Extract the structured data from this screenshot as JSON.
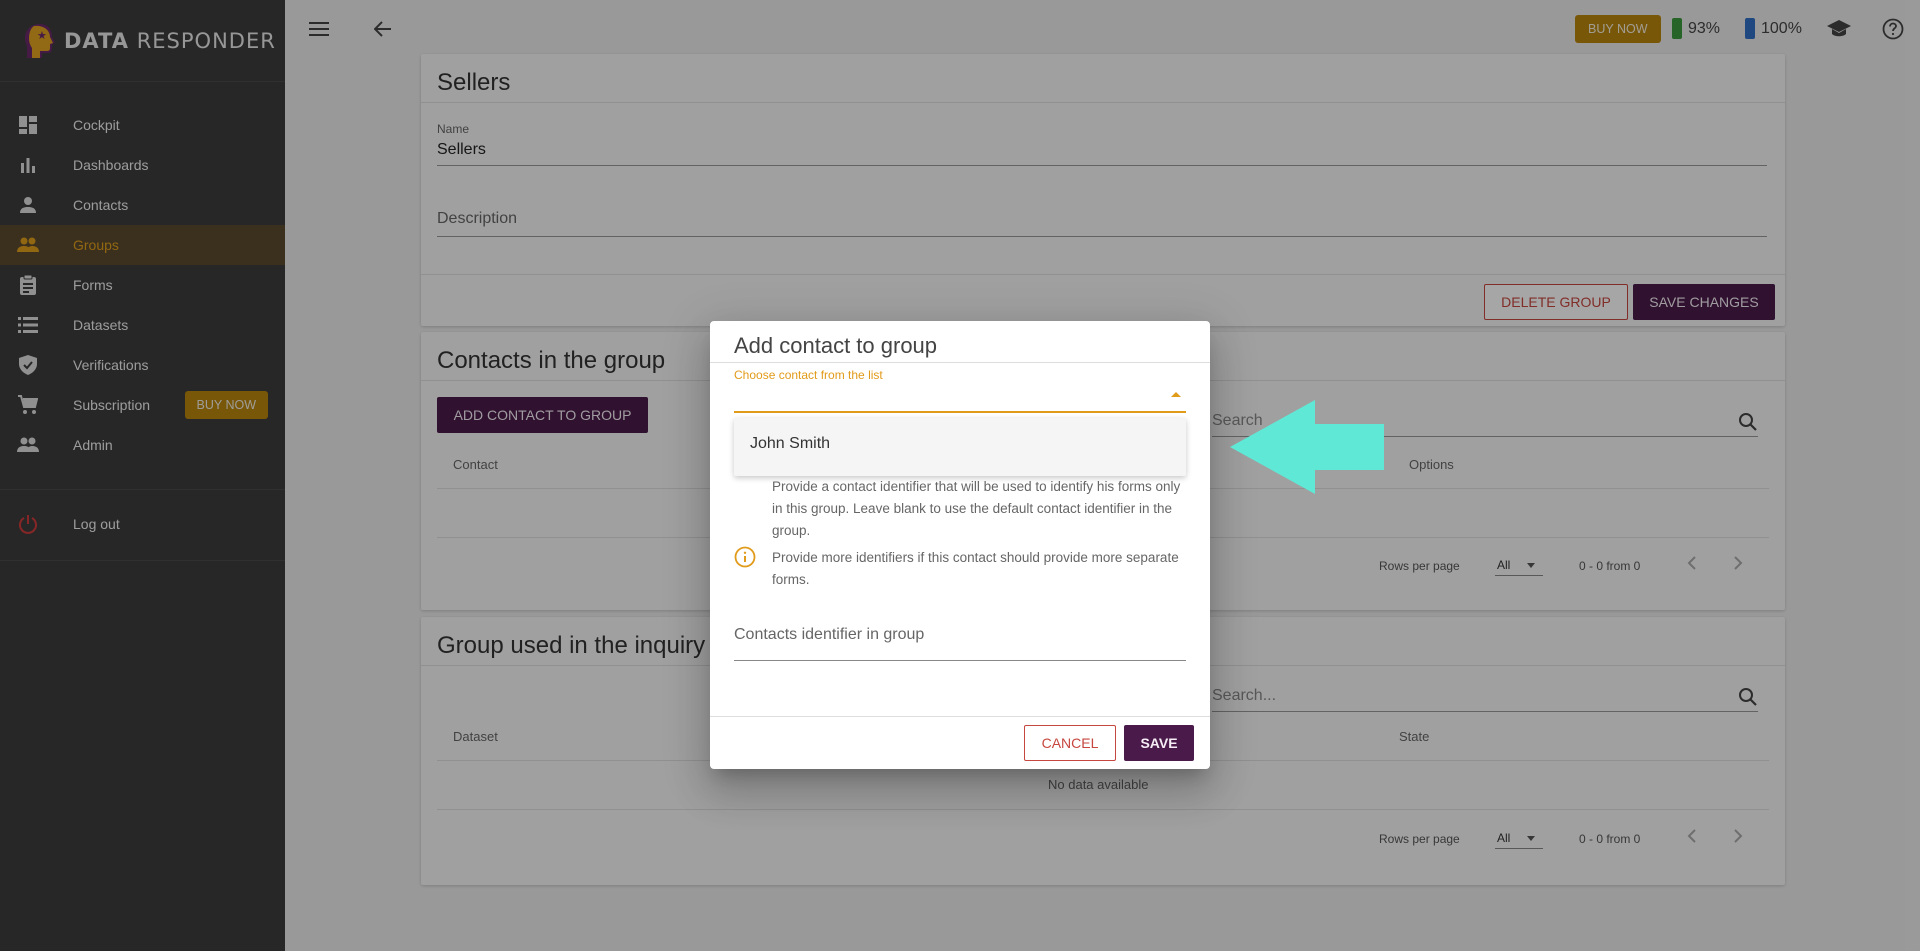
{
  "app": {
    "logo_bold": "DATA",
    "logo_rest": " RESPONDER"
  },
  "sidebar": {
    "items": [
      {
        "label": "Cockpit",
        "icon": "dashboard-grid-icon"
      },
      {
        "label": "Dashboards",
        "icon": "bar-chart-icon"
      },
      {
        "label": "Contacts",
        "icon": "person-icon"
      },
      {
        "label": "Groups",
        "icon": "people-icon",
        "active": true
      },
      {
        "label": "Forms",
        "icon": "clipboard-icon"
      },
      {
        "label": "Datasets",
        "icon": "list-icon"
      },
      {
        "label": "Verifications",
        "icon": "shield-check-icon"
      },
      {
        "label": "Subscription",
        "icon": "cart-icon",
        "badge": "BUY NOW"
      },
      {
        "label": "Admin",
        "icon": "admin-people-icon"
      }
    ],
    "logout": "Log out"
  },
  "topbar": {
    "buy_now": "BUY NOW",
    "battery1": "93%",
    "battery2": "100%"
  },
  "group_card": {
    "title": "Sellers",
    "name_label": "Name",
    "name_value": "Sellers",
    "description_placeholder": "Description",
    "delete_label": "DELETE GROUP",
    "save_label": "SAVE CHANGES"
  },
  "contacts_card": {
    "title": "Contacts in the group",
    "add_label": "ADD CONTACT TO GROUP",
    "search_placeholder": "Search",
    "col_contact": "Contact",
    "col_options": "Options",
    "rows_per_page": "Rows per page",
    "rows_value": "All",
    "range": "0 - 0 from 0"
  },
  "inquiry_card": {
    "title": "Group used in the inquiry",
    "search_placeholder": "Search...",
    "col_dataset": "Dataset",
    "col_state": "State",
    "no_data": "No data available",
    "rows_per_page": "Rows per page",
    "rows_value": "All",
    "range": "0 - 0 from 0"
  },
  "dialog": {
    "title": "Add contact to group",
    "choose_label": "Choose contact from the list",
    "option": "John Smith",
    "info1": "Provide a contact identifier that will be used to identify his forms only in this group. Leave blank to use the default contact identifier in the group.",
    "info2": "Provide more identifiers if this contact should provide more separate forms.",
    "identifier_placeholder": "Contacts identifier in group",
    "cancel": "CANCEL",
    "save": "SAVE"
  },
  "colors": {
    "accent": "#e19b1a",
    "primary": "#4a1b4a",
    "danger": "#c6473f",
    "arrow": "#5fe8d6"
  }
}
